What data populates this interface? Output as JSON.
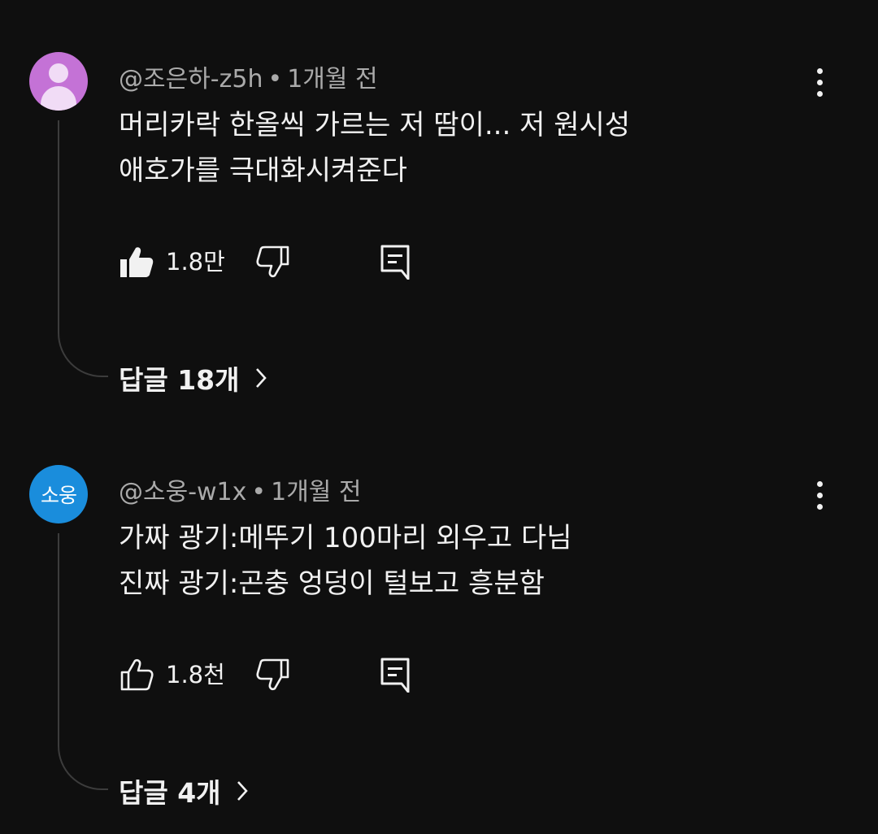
{
  "comments": [
    {
      "author": "@조은하-z5h",
      "separator": "•",
      "time": "1개월 전",
      "avatar_type": "default-person",
      "avatar_color": "#c472d6",
      "lines": [
        "머리카락 한올씩 가르는 저 땀이... 저 원시성",
        "애호가를 극대화시켜준다"
      ],
      "like_count": "1.8만",
      "liked": true,
      "replies_label": "답글 18개"
    },
    {
      "author": "@소웅-w1x",
      "separator": "•",
      "time": "1개월 전",
      "avatar_type": "initials",
      "avatar_text": "소웅",
      "avatar_color": "#1a8ddc",
      "lines": [
        "가짜 광기:메뚜기 100마리 외우고 다님",
        "진짜 광기:곤충 엉덩이 털보고 흥분함"
      ],
      "like_count": "1.8천",
      "liked": false,
      "replies_label": "답글 4개"
    }
  ],
  "icons": {
    "like_filled": "thumb-up-filled-icon",
    "like_outline": "thumb-up-outline-icon",
    "dislike": "thumb-down-outline-icon",
    "reply": "comment-reply-icon",
    "more": "more-vertical-icon",
    "replies_chevron": "chevron-right-icon"
  },
  "colors": {
    "background": "#0f0f0f",
    "text": "#f1f1f1",
    "meta": "#aaaaaa",
    "thread_line": "#3c3c3c"
  }
}
